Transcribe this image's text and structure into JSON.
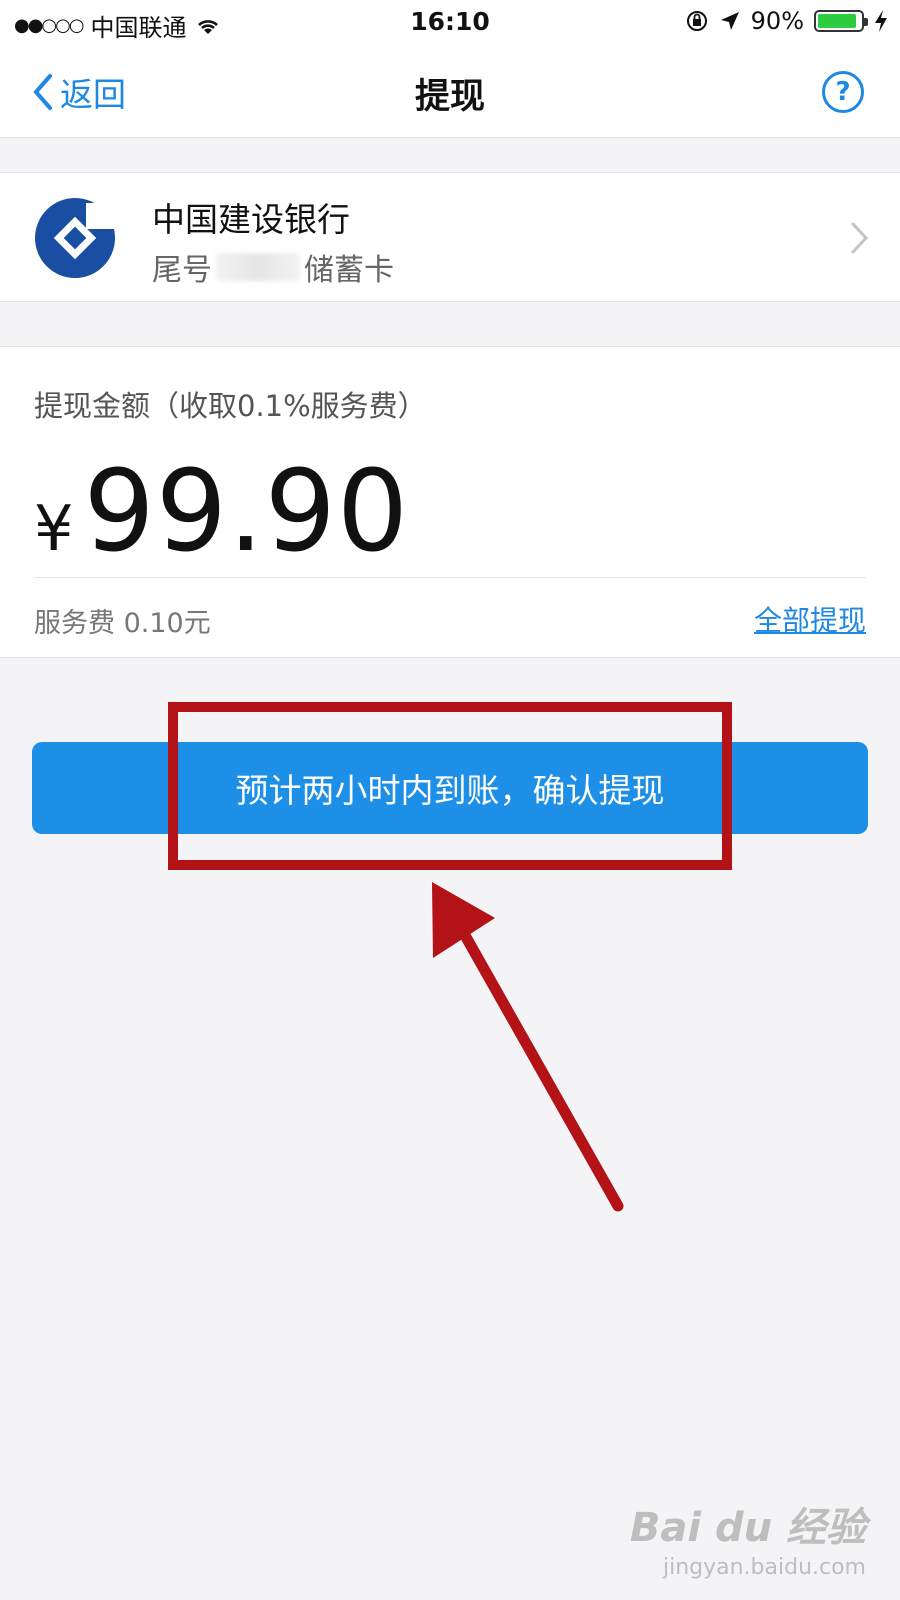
{
  "status_bar": {
    "signal": "●●○○○",
    "carrier": "中国联通",
    "time": "16:10",
    "battery_percent": "90%",
    "battery_level": 0.9
  },
  "nav": {
    "back_label": "返回",
    "title": "提现",
    "help_label": "?"
  },
  "bank": {
    "name": "中国建设银行",
    "card_prefix": "尾号",
    "card_type": "储蓄卡",
    "logo_color": "#1a4ea3"
  },
  "amount": {
    "label": "提现金额（收取0.1%服务费）",
    "currency": "¥",
    "value": "99.90",
    "fee": "服务费 0.10元",
    "withdraw_all": "全部提现"
  },
  "confirm": {
    "label": "预计两小时内到账，确认提现"
  },
  "colors": {
    "accent": "#1e88e5",
    "button": "#1e8fe6",
    "annotation": "#b31217",
    "battery": "#2ecc40"
  },
  "watermark": {
    "main": "Bai du 经验",
    "sub": "jingyan.baidu.com"
  }
}
